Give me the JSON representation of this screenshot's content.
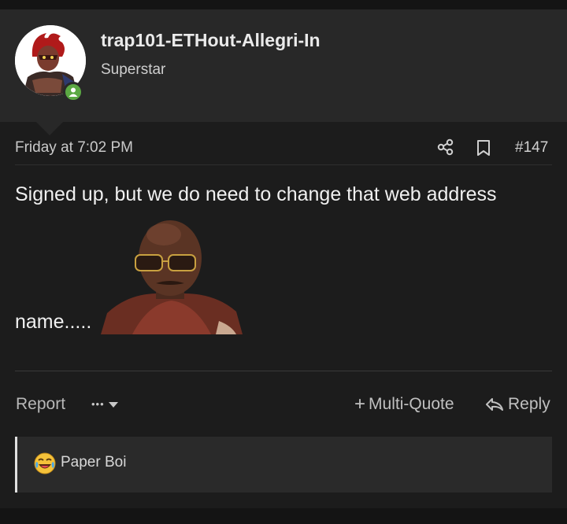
{
  "user": {
    "username": "trap101-ETHout-Allegri-In",
    "title": "Superstar",
    "online_color": "#5ba843"
  },
  "post": {
    "date": "Friday at 7:02 PM",
    "number": "#147",
    "body_line1": "Signed up, but we do need to change that web address",
    "body_line2": "name.....",
    "image_description_icon": "reaction-gif"
  },
  "actions": {
    "report": "Report",
    "more": "•••",
    "multiquote": "Multi-Quote",
    "reply": "Reply"
  },
  "reactions": {
    "emoji": "laughing-emoji",
    "text": "Paper Boi"
  },
  "colors": {
    "header_bg": "#282828",
    "post_bg": "#1c1c1c",
    "page_bg": "#121212"
  }
}
